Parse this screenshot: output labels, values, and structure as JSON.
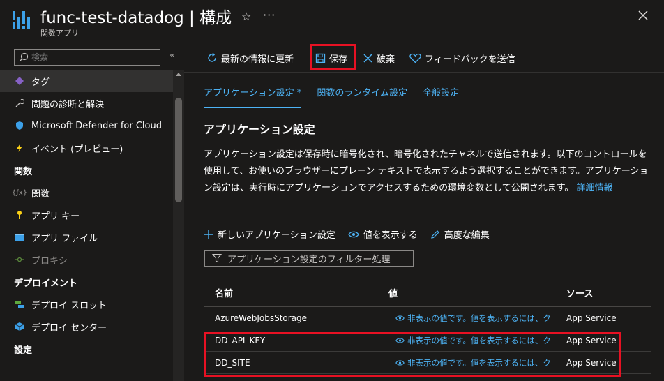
{
  "header": {
    "title": "func-test-datadog | 構成",
    "subtitle": "関数アプリ",
    "more": "···"
  },
  "sidebar": {
    "search_placeholder": "検索",
    "collapse": "«",
    "items": [
      {
        "type": "item",
        "label": "タグ",
        "icon": "tag-icon",
        "active": true
      },
      {
        "type": "item",
        "label": "問題の診断と解決",
        "icon": "wrench-icon"
      },
      {
        "type": "item",
        "label": "Microsoft Defender for Cloud",
        "icon": "shield-icon"
      },
      {
        "type": "item",
        "label": "イベント (プレビュー)",
        "icon": "lightning-icon"
      },
      {
        "type": "section",
        "label": "関数"
      },
      {
        "type": "item",
        "label": "関数",
        "icon": "function-icon"
      },
      {
        "type": "item",
        "label": "アプリ キー",
        "icon": "key-icon"
      },
      {
        "type": "item",
        "label": "アプリ ファイル",
        "icon": "code-file-icon"
      },
      {
        "type": "item",
        "label": "プロキシ",
        "icon": "proxy-icon",
        "disabled": true
      },
      {
        "type": "section",
        "label": "デプロイメント"
      },
      {
        "type": "item",
        "label": "デプロイ スロット",
        "icon": "slots-icon"
      },
      {
        "type": "item",
        "label": "デプロイ センター",
        "icon": "cube-icon"
      },
      {
        "type": "section",
        "label": "設定"
      }
    ]
  },
  "toolbar": {
    "refresh_label": "最新の情報に更新",
    "save_label": "保存",
    "discard_label": "破棄",
    "feedback_label": "フィードバックを送信"
  },
  "tabs": [
    {
      "label": "アプリケーション設定 *",
      "active": true
    },
    {
      "label": "関数のランタイム設定",
      "active": false
    },
    {
      "label": "全般設定",
      "active": false
    }
  ],
  "section_title": "アプリケーション設定",
  "description": "アプリケーション設定は保存時に暗号化され、暗号化されたチャネルで送信されます。以下のコントロールを使用して、お使いのブラウザーにプレーン テキストで表示するよう選択することができます。アプリケーション設定は、実行時にアプリケーションでアクセスするための環境変数として公開されます。",
  "learn_more": "詳細情報",
  "subtoolbar": {
    "new_label": "新しいアプリケーション設定",
    "show_values_label": "値を表示する",
    "advanced_edit_label": "高度な編集"
  },
  "filter_placeholder": "アプリケーション設定のフィルター処理",
  "table": {
    "headers": {
      "name": "名前",
      "value": "値",
      "source": "ソース"
    },
    "rows": [
      {
        "name": "AzureWebJobsStorage",
        "value": "非表示の値です。値を表示するには、ク",
        "source": "App Service"
      },
      {
        "name": "DD_API_KEY",
        "value": "非表示の値です。値を表示するには、ク",
        "source": "App Service"
      },
      {
        "name": "DD_SITE",
        "value": "非表示の値です。値を表示するには、ク",
        "source": "App Service"
      }
    ]
  },
  "colors": {
    "accent": "#4db3f5",
    "highlight": "#e81123",
    "background": "#1b1a19"
  }
}
